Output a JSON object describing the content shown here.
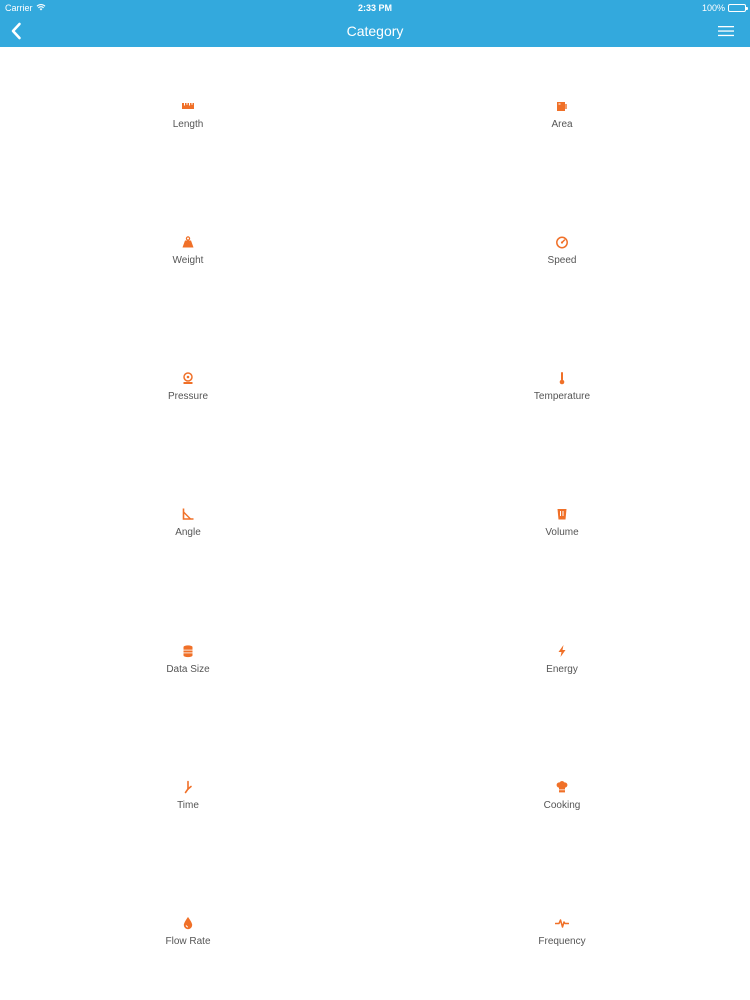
{
  "status_bar": {
    "carrier": "Carrier",
    "time": "2:33 PM",
    "battery": "100%"
  },
  "nav": {
    "title": "Category",
    "back_icon": "chevron-left-icon",
    "menu_icon": "hamburger-menu-icon"
  },
  "colors": {
    "header": "#33a9dd",
    "accent": "#f07028",
    "label": "#555555"
  },
  "categories": [
    {
      "label": "Length",
      "icon": "ruler-icon"
    },
    {
      "label": "Area",
      "icon": "area-icon"
    },
    {
      "label": "Weight",
      "icon": "weight-icon"
    },
    {
      "label": "Speed",
      "icon": "speedometer-icon"
    },
    {
      "label": "Pressure",
      "icon": "pressure-gauge-icon"
    },
    {
      "label": "Temperature",
      "icon": "thermometer-icon"
    },
    {
      "label": "Angle",
      "icon": "angle-icon"
    },
    {
      "label": "Volume",
      "icon": "volume-icon"
    },
    {
      "label": "Data Size",
      "icon": "database-icon"
    },
    {
      "label": "Energy",
      "icon": "lightning-icon"
    },
    {
      "label": "Time",
      "icon": "clock-hand-icon"
    },
    {
      "label": "Cooking",
      "icon": "chef-hat-icon"
    },
    {
      "label": "Flow Rate",
      "icon": "droplet-icon"
    },
    {
      "label": "Frequency",
      "icon": "pulse-wave-icon"
    }
  ]
}
